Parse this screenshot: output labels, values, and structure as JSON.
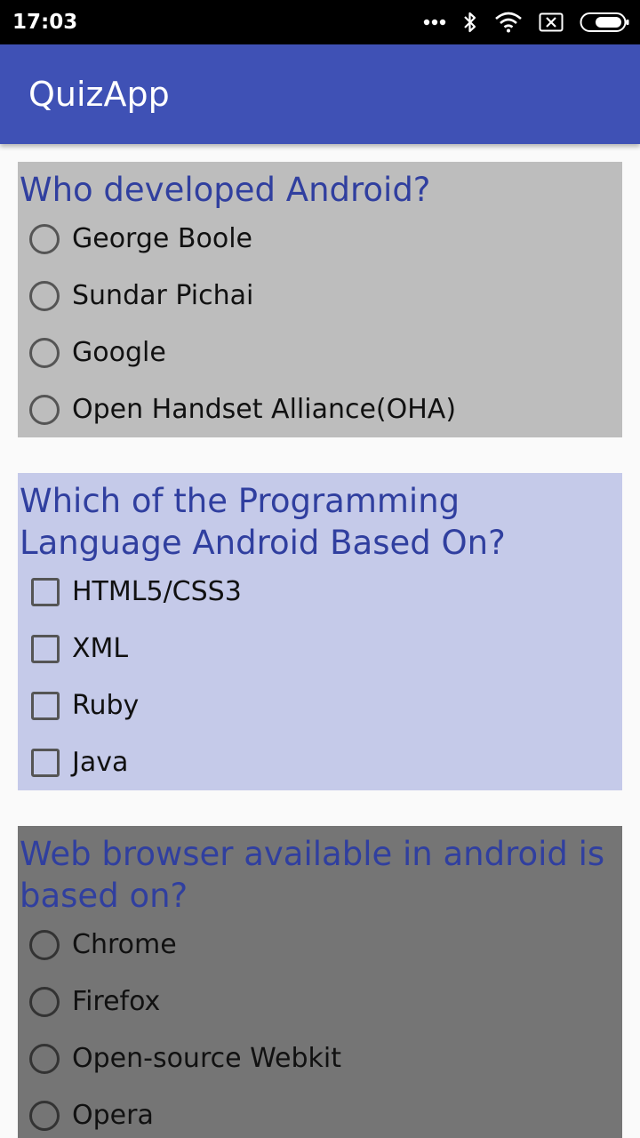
{
  "status_bar": {
    "time": "17:03",
    "icons": [
      "more-dots-icon",
      "bluetooth-icon",
      "wifi-icon",
      "sim-x-icon",
      "battery-icon"
    ]
  },
  "app_bar": {
    "title": "QuizApp",
    "color": "#3f51b5"
  },
  "questions": [
    {
      "title": "Who developed Android?",
      "input_type": "radio",
      "background": "#bdbdbd",
      "options": [
        "George Boole",
        "Sundar Pichai",
        "Google",
        "Open Handset Alliance(OHA)"
      ]
    },
    {
      "title": "Which of the Programming Language Android Based On?",
      "input_type": "checkbox",
      "background": "#c5cae9",
      "options": [
        "HTML5/CSS3",
        "XML",
        "Ruby",
        "Java"
      ]
    },
    {
      "title": "Web browser available in android is based on?",
      "input_type": "radio",
      "background": "#757575",
      "options": [
        "Chrome",
        "Firefox",
        "Open-source Webkit",
        "Opera"
      ]
    }
  ]
}
